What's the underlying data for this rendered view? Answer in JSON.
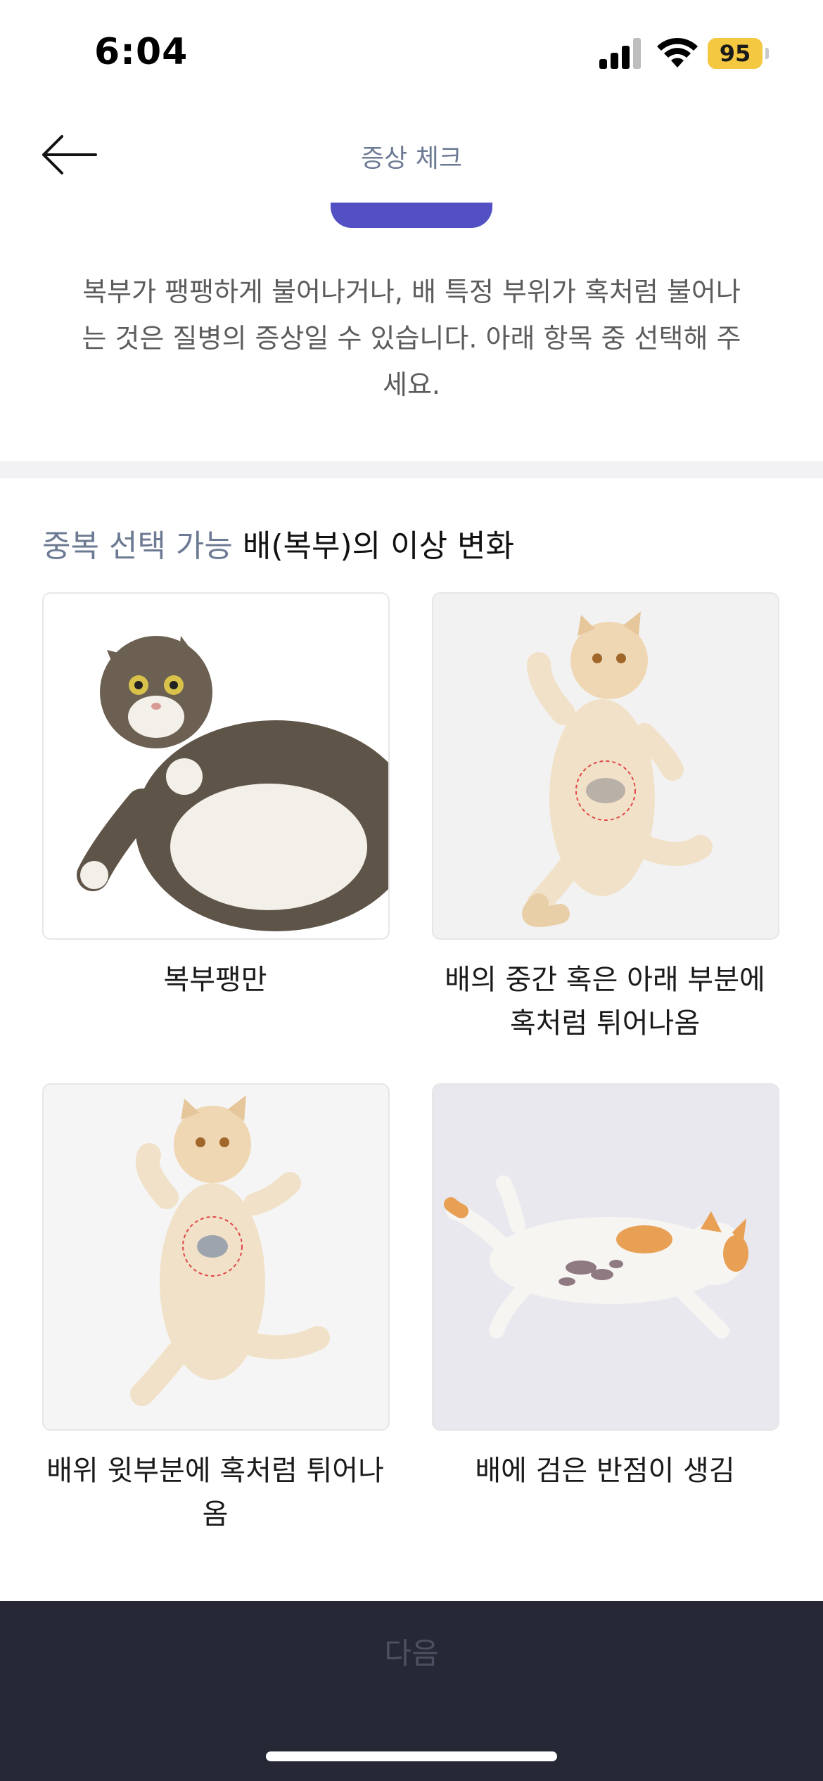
{
  "status_bar": {
    "time": "6:04",
    "battery": "95",
    "icons": [
      "signal-icon",
      "wifi-icon",
      "battery-icon"
    ]
  },
  "nav": {
    "back_icon": "arrow-left-icon",
    "title": "증상 체크"
  },
  "progress": {
    "accent_color": "#5350c4"
  },
  "description": "복부가 팽팽하게 불어나거나, 배 특정 부위가 혹처럼 불어나는 것은 질병의 증상일 수 있습니다. 아래 항목 중 선택해 주세요.",
  "section": {
    "tag": "중복 선택 가능",
    "title": "배(복부)의 이상 변화"
  },
  "options": [
    {
      "label": "복부팽만",
      "image": "bloated-belly-cat-photo"
    },
    {
      "label": "배의 중간 혹은 아래 부분에 혹처럼 튀어나옴",
      "image": "cat-lower-belly-lump-photo"
    },
    {
      "label": "배위 윗부분에 혹처럼 튀어나옴",
      "image": "cat-upper-belly-lump-photo"
    },
    {
      "label": "배에 검은 반점이 생김",
      "image": "cat-black-spots-belly-photo"
    }
  ],
  "footer": {
    "next_label": "다음"
  },
  "colors": {
    "tag": "#6d7a93",
    "footer_bg": "#262836",
    "footer_text_disabled": "#4e5061",
    "lump_marker": "#e04848"
  }
}
